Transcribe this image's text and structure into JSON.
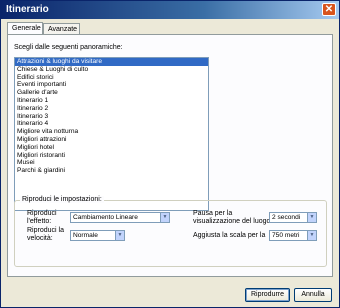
{
  "window": {
    "title": "Itinerario"
  },
  "tabs": [
    {
      "label": "Generale"
    },
    {
      "label": "Avanzate"
    }
  ],
  "panorama": {
    "heading": "Scegli dalle seguenti panoramiche:",
    "items": [
      "Attrazioni & luoghi da visitare",
      "Chiese & Luoghi di culto",
      "Edifici storici",
      "Eventi importanti",
      "Gallerie d'arte",
      "Itinerario 1",
      "Itinerario 2",
      "Itinerario 3",
      "Itinerario 4",
      "Migliore vita notturna",
      "Migliori attrazioni",
      "Migliori hotel",
      "Migliori ristoranti",
      "Musei",
      "Parchi & giardini"
    ],
    "selected_index": 0
  },
  "settings": {
    "group_title": "Riproduci le impostazioni:",
    "effect_label_1": "Riproduci",
    "effect_label_2": "l'effetto:",
    "effect_value": "Cambiamento Lineare",
    "speed_label_1": "Riproduci la",
    "speed_label_2": "velocità:",
    "speed_value": "Normale",
    "pause_label_1": "Pausa per la",
    "pause_label_2": "visualizzazione del luogo:",
    "pause_value": "2 secondi",
    "scale_label": "Aggiusta la scala per la",
    "scale_value": "750 metri"
  },
  "buttons": {
    "play": "Riprodurre",
    "cancel": "Annulla"
  }
}
